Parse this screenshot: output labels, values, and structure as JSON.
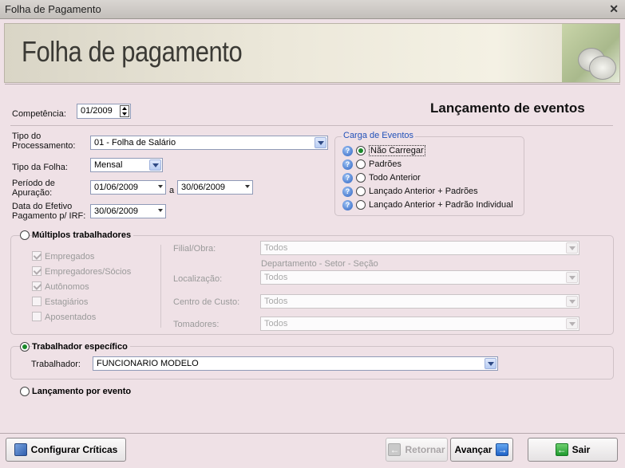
{
  "window": {
    "title": "Folha de Pagamento",
    "close_glyph": "✕"
  },
  "banner": {
    "title": "Folha de pagamento",
    "image_icon": "money-coins-icon"
  },
  "header": {
    "competencia_label": "Competência:",
    "competencia_value": "01/2009",
    "section_title": "Lançamento de eventos"
  },
  "form": {
    "tipo_processamento_label_1": "Tipo do",
    "tipo_processamento_label_2": "Processamento:",
    "tipo_processamento_value": "01 - Folha de Salário",
    "tipo_folha_label": "Tipo da Folha:",
    "tipo_folha_value": "Mensal",
    "periodo_label_1": "Período de",
    "periodo_label_2": "Apuração:",
    "periodo_inicio": "01/06/2009",
    "periodo_sep": "a",
    "periodo_fim": "30/06/2009",
    "data_pgto_label_1": "Data do Efetivo",
    "data_pgto_label_2": "Pagamento p/ IRF:",
    "data_pgto_value": "30/06/2009"
  },
  "carga_eventos": {
    "title": "Carga de Eventos",
    "options": [
      "Não Carregar",
      "Padrões",
      "Todo Anterior",
      "Lançado Anterior + Padrões",
      "Lançado Anterior + Padrão Individual"
    ],
    "selected_index": 0
  },
  "multiplos": {
    "label": "Múltiplos trabalhadores",
    "checkboxes": [
      {
        "label": "Empregados",
        "checked": true
      },
      {
        "label": "Empregadores/Sócios",
        "checked": true
      },
      {
        "label": "Autônomos",
        "checked": true
      },
      {
        "label": "Estagiários",
        "checked": false
      },
      {
        "label": "Aposentados",
        "checked": false
      }
    ],
    "filial_label": "Filial/Obra:",
    "filial_value": "Todos",
    "dept_caption": "Departamento - Setor - Seção",
    "localizacao_label": "Localização:",
    "localizacao_value": "Todos",
    "centro_label": "Centro de Custo:",
    "centro_value": "Todos",
    "tomadores_label": "Tomadores:",
    "tomadores_value": "Todos"
  },
  "especifico": {
    "label": "Trabalhador específico",
    "trabalhador_label": "Trabalhador:",
    "trabalhador_value": "FUNCIONARIO MODELO"
  },
  "por_evento": {
    "label": "Lançamento por evento"
  },
  "footer": {
    "configurar_label": "Configurar Críticas",
    "retornar_label": "Retornar",
    "avancar_label": "Avançar",
    "sair_label": "Sair"
  },
  "colors": {
    "accent": "#1a8a2a",
    "background": "#efe1e6",
    "section_title": "#000000"
  }
}
